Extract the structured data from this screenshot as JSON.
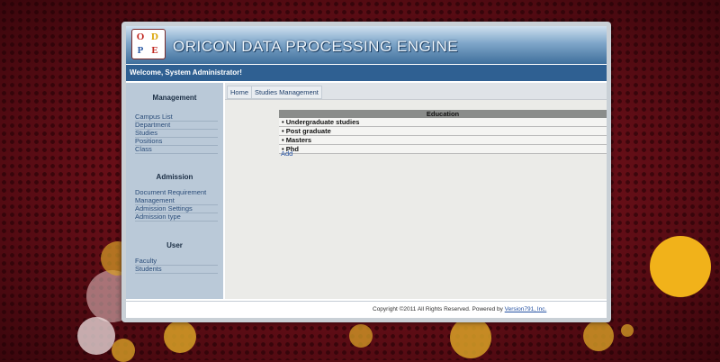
{
  "app": {
    "title": "ORICON DATA PROCESSING ENGINE",
    "logo_letters": [
      "O",
      "D",
      "P",
      "E"
    ],
    "welcome": "Welcome, System Administrator!"
  },
  "sidebar": {
    "sections": [
      {
        "heading": "Management",
        "items": [
          "Campus List",
          "Department",
          "Studies",
          "Positions",
          "Class"
        ]
      },
      {
        "heading": "Admission",
        "items": [
          "Document Requirement Management",
          "Admission Settings",
          "Admission type"
        ]
      },
      {
        "heading": "User",
        "items": [
          "Faculty",
          "Students"
        ]
      }
    ]
  },
  "tabs": [
    "Home",
    "Studies Management"
  ],
  "education_table": {
    "header": "Education",
    "rows": [
      "Undergraduate studies",
      "Post graduate",
      "Masters",
      "Phd"
    ],
    "bullet": "•"
  },
  "add_link": "Add",
  "footer": {
    "text": "Copyright ©2011 All Rights Reserved. Powered by",
    "link": "Version791, Inc."
  },
  "colors": {
    "banner_dark": "#3f6f9c",
    "welcome_bar": "#2f6092",
    "sidebar_bg": "#bac9d8",
    "link": "#2552a3"
  }
}
